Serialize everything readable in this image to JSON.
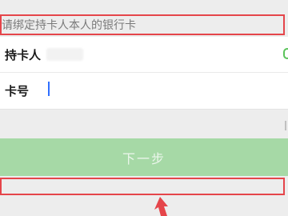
{
  "hint": {
    "text": "请绑定持卡人本人的银行卡"
  },
  "form": {
    "cardholder_label": "持卡人",
    "card_number_label": "卡号",
    "card_number_value": ""
  },
  "actions": {
    "next_label": "下一步"
  },
  "colors": {
    "annotation": "#e5454a",
    "button_disabled": "#a6d9a6",
    "caret": "#2f6fff",
    "accent_green": "#5ac35a"
  },
  "icons": {
    "edge_icon": "green-circle-icon",
    "arrow_icon": "red-arrow-icon"
  }
}
